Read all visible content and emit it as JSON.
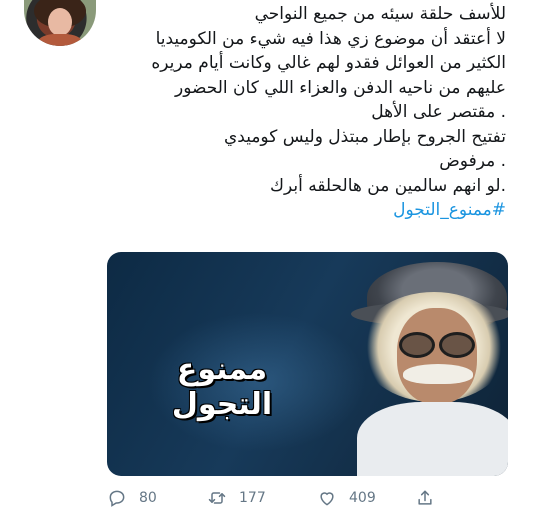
{
  "tweet": {
    "lines": [
      "للأسف حلقة سيئه من جميع النواحي",
      "لا أعتقد أن موضوع زي هذا فيه شيء من الكوميديا",
      "الكثير من العوائل فقدو لهم غالي وكانت أيام مريره",
      "عليهم من ناحيه الدفن والعزاء اللي كان الحضور",
      ". مقتصر على الأهل",
      "تفتيح الجروح بإطار مبتذل وليس كوميدي",
      ". مرفوض",
      ".لو انهم سالمين من هالحلقه أبرك"
    ],
    "hashtag": "#ممنوع_التجول"
  },
  "media": {
    "title": "ممنوع التجول"
  },
  "actions": {
    "replies": "80",
    "retweets": "177",
    "likes": "409"
  },
  "icons": {
    "avatar": "user-avatar",
    "reply": "reply-icon",
    "retweet": "retweet-icon",
    "like": "heart-icon",
    "share": "share-icon"
  },
  "colors": {
    "text": "#14171a",
    "hashtag": "#1b95e0",
    "muted": "#657786"
  }
}
